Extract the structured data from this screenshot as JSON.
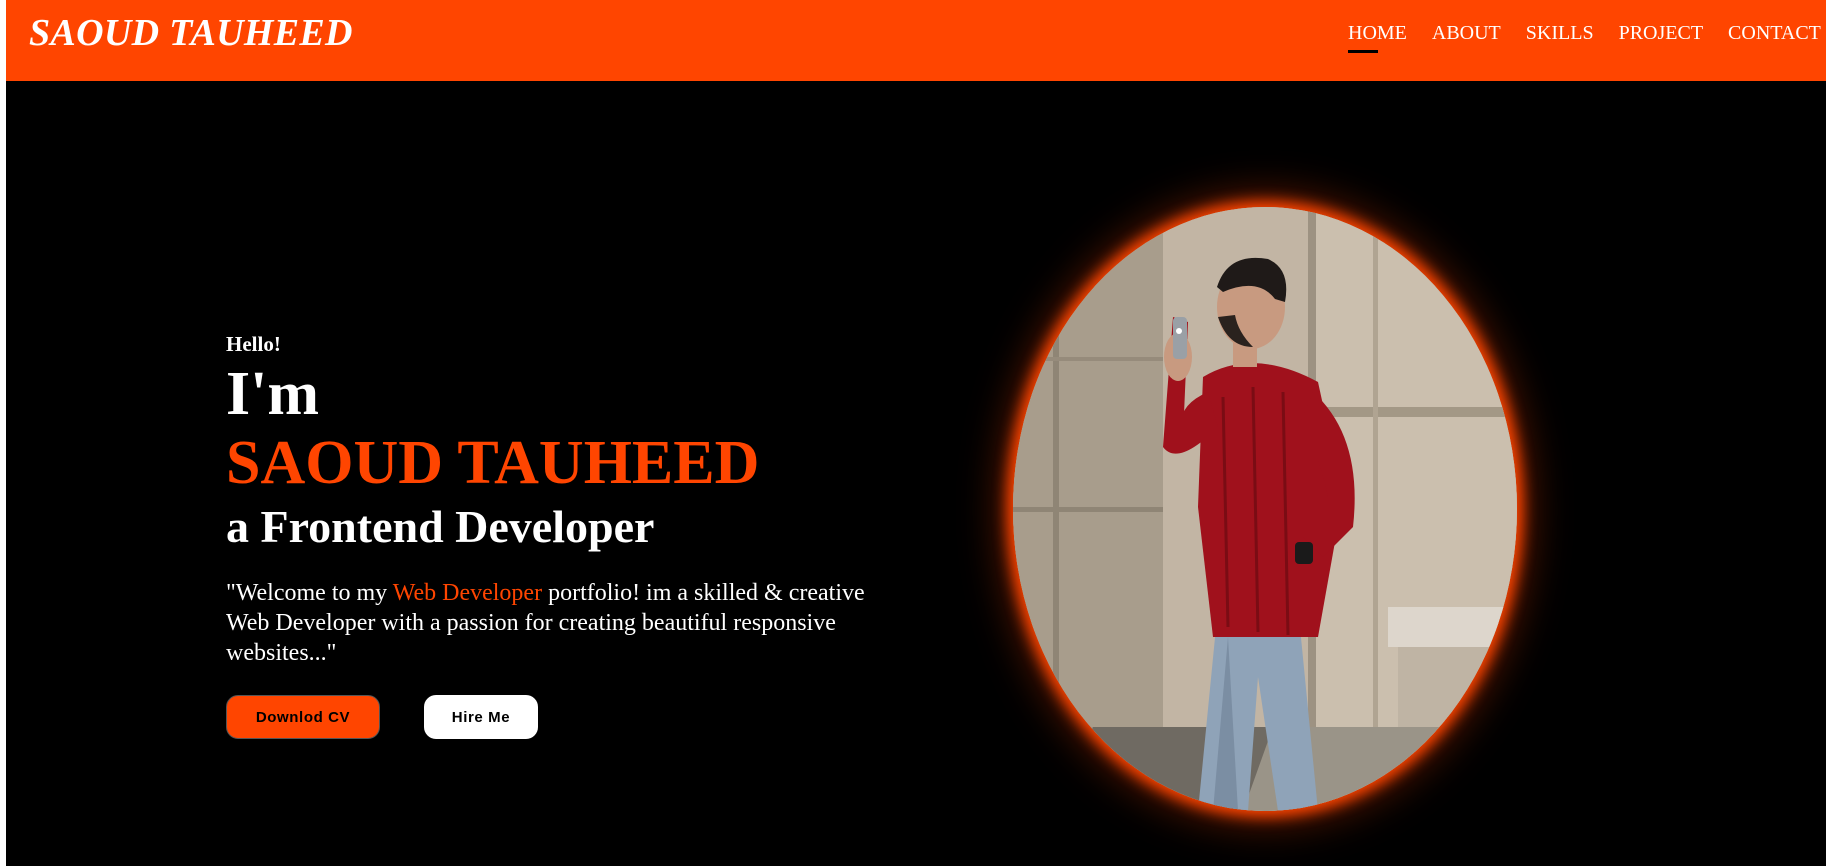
{
  "header": {
    "logo": "SAOUD TAUHEED",
    "nav": [
      {
        "label": "HOME",
        "active": true
      },
      {
        "label": "ABOUT",
        "active": false
      },
      {
        "label": "SKILLS",
        "active": false
      },
      {
        "label": "PROJECT",
        "active": false
      },
      {
        "label": "CONTACT",
        "active": false
      }
    ]
  },
  "hero": {
    "greeting": "Hello!",
    "intro_prefix": "I'm",
    "name": "SAOUD TAUHEED",
    "role": "a Frontend Developer",
    "description_before": "\"Welcome to my ",
    "description_highlight": "Web Developer",
    "description_after": " portfolio! im a skilled & creative Web Developer with a passion for creating beautiful responsive websites...\"",
    "buttons": {
      "cv": "Downlod CV",
      "hire": "Hire Me"
    }
  },
  "colors": {
    "accent": "#ff4500",
    "background": "#000000",
    "text": "#ffffff"
  },
  "portrait": {
    "icon": "profile-photo"
  }
}
